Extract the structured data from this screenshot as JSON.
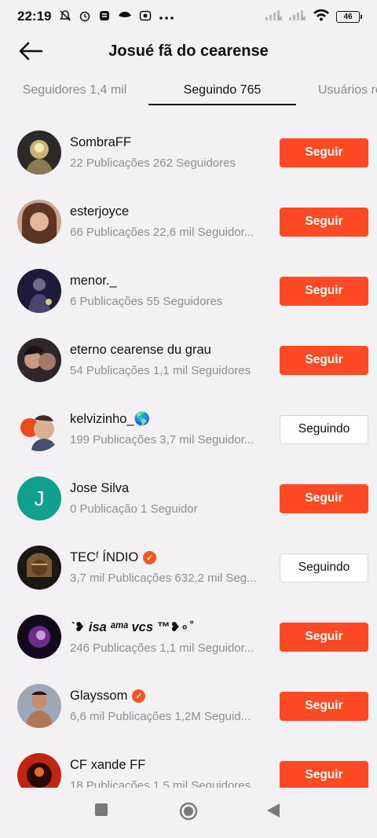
{
  "status_bar": {
    "time": "22:19",
    "battery": "46",
    "icons": [
      "bell-off-icon",
      "alarm-icon",
      "app-icon",
      "eye-icon",
      "media-icon",
      "more-dots-icon",
      "signal-icon",
      "signal-icon",
      "wifi-icon",
      "battery-icon"
    ]
  },
  "header": {
    "title": "Josué fã do cearense",
    "back_icon": "arrow-left-icon"
  },
  "tabs": [
    {
      "label": "Seguidores 1,4 mil",
      "active": false
    },
    {
      "label": "Seguindo 765",
      "active": true
    },
    {
      "label": "Usuários re",
      "active": false
    }
  ],
  "users": [
    {
      "name": "SombraFF",
      "meta": "22 Publicações 262 Seguidores",
      "button": "Seguir",
      "state": "follow",
      "verified": false
    },
    {
      "name": "esterjoyce",
      "meta": "66 Publicações 22,6 mil Seguidor...",
      "button": "Seguir",
      "state": "follow",
      "verified": false
    },
    {
      "name": "menor._",
      "meta": "6 Publicações 55 Seguidores",
      "button": "Seguir",
      "state": "follow",
      "verified": false
    },
    {
      "name": "eterno cearense du grau",
      "meta": "54 Publicações 1,1 mil Seguidores",
      "button": "Seguir",
      "state": "follow",
      "verified": false
    },
    {
      "name": "kelvizinho_🌎",
      "meta": "199 Publicações 3,7 mil Seguidor...",
      "button": "Seguindo",
      "state": "following",
      "verified": false
    },
    {
      "name": "Jose Silva",
      "meta": "0 Publicação 1 Seguidor",
      "button": "Seguir",
      "state": "follow",
      "verified": false,
      "avatar_letter": "J"
    },
    {
      "name": "TECᶠ    ÍNDIO",
      "meta": "3,7 mil Publicações 632,2 mil Seg...",
      "button": "Seguindo",
      "state": "following",
      "verified": true
    },
    {
      "name": "ˋ❥ isa ᵃᵐᵃ vcs ™❥∘˚",
      "meta": "246 Publicações 1,1 mil Seguidor...",
      "button": "Seguir",
      "state": "follow",
      "verified": false
    },
    {
      "name": "Glayssom",
      "meta": "6,6 mil Publicações 1,2M Seguid...",
      "button": "Seguir",
      "state": "follow",
      "verified": true
    },
    {
      "name": "CF xande FF",
      "meta": "18 Publicações 1,5 mil Seguidores",
      "button": "Seguir",
      "state": "follow",
      "verified": false
    }
  ],
  "nav": [
    "recent-apps-icon",
    "home-icon",
    "back-icon"
  ],
  "colors": {
    "accent": "#fe4a22",
    "background": "#f3f1f4",
    "verified": "#f05a22",
    "avatar_teal": "#12a08e"
  }
}
